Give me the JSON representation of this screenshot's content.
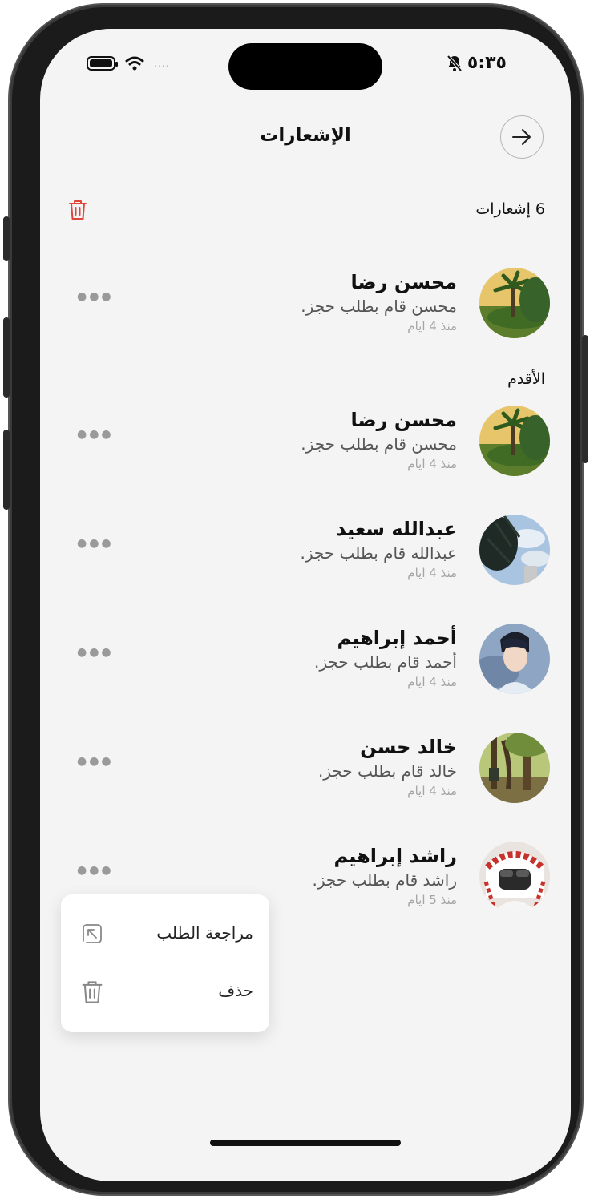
{
  "status": {
    "time": "٥:٣٥",
    "signal_dots": "....",
    "icons": [
      "battery-icon",
      "wifi-icon",
      "bell-slash-icon"
    ]
  },
  "header": {
    "title": "الإشعارات",
    "back_icon": "arrow-right-icon"
  },
  "summary": {
    "count_label": "6 إشعارات",
    "delete_all_icon": "trash-icon",
    "accent": "#e0453a"
  },
  "sections": {
    "older_label": "الأقدم"
  },
  "notifications": [
    {
      "name": "محسن رضا",
      "message": "محسن قام بطلب حجز.",
      "time": "منذ 4 ايام",
      "avatar": "palm-landscape"
    },
    {
      "name": "محسن رضا",
      "message": "محسن قام بطلب حجز.",
      "time": "منذ 4 ايام",
      "avatar": "palm-landscape"
    },
    {
      "name": "عبدالله سعيد",
      "message": "عبدالله قام بطلب حجز.",
      "time": "منذ 4 ايام",
      "avatar": "sky-trees"
    },
    {
      "name": "أحمد إبراهيم",
      "message": "أحمد قام بطلب حجز.",
      "time": "منذ 4 ايام",
      "avatar": "anime-portrait"
    },
    {
      "name": "خالد حسن",
      "message": "خالد قام بطلب حجز.",
      "time": "منذ 4 ايام",
      "avatar": "forest-reader"
    },
    {
      "name": "راشد إبراهيم",
      "message": "راشد قام بطلب حجز.",
      "time": "منذ 5 ايام",
      "avatar": "man-shemagh"
    }
  ],
  "context_menu": {
    "review_label": "مراجعة الطلب",
    "review_icon": "arrow-up-left-square-icon",
    "delete_label": "حذف",
    "delete_icon": "trash-icon"
  }
}
